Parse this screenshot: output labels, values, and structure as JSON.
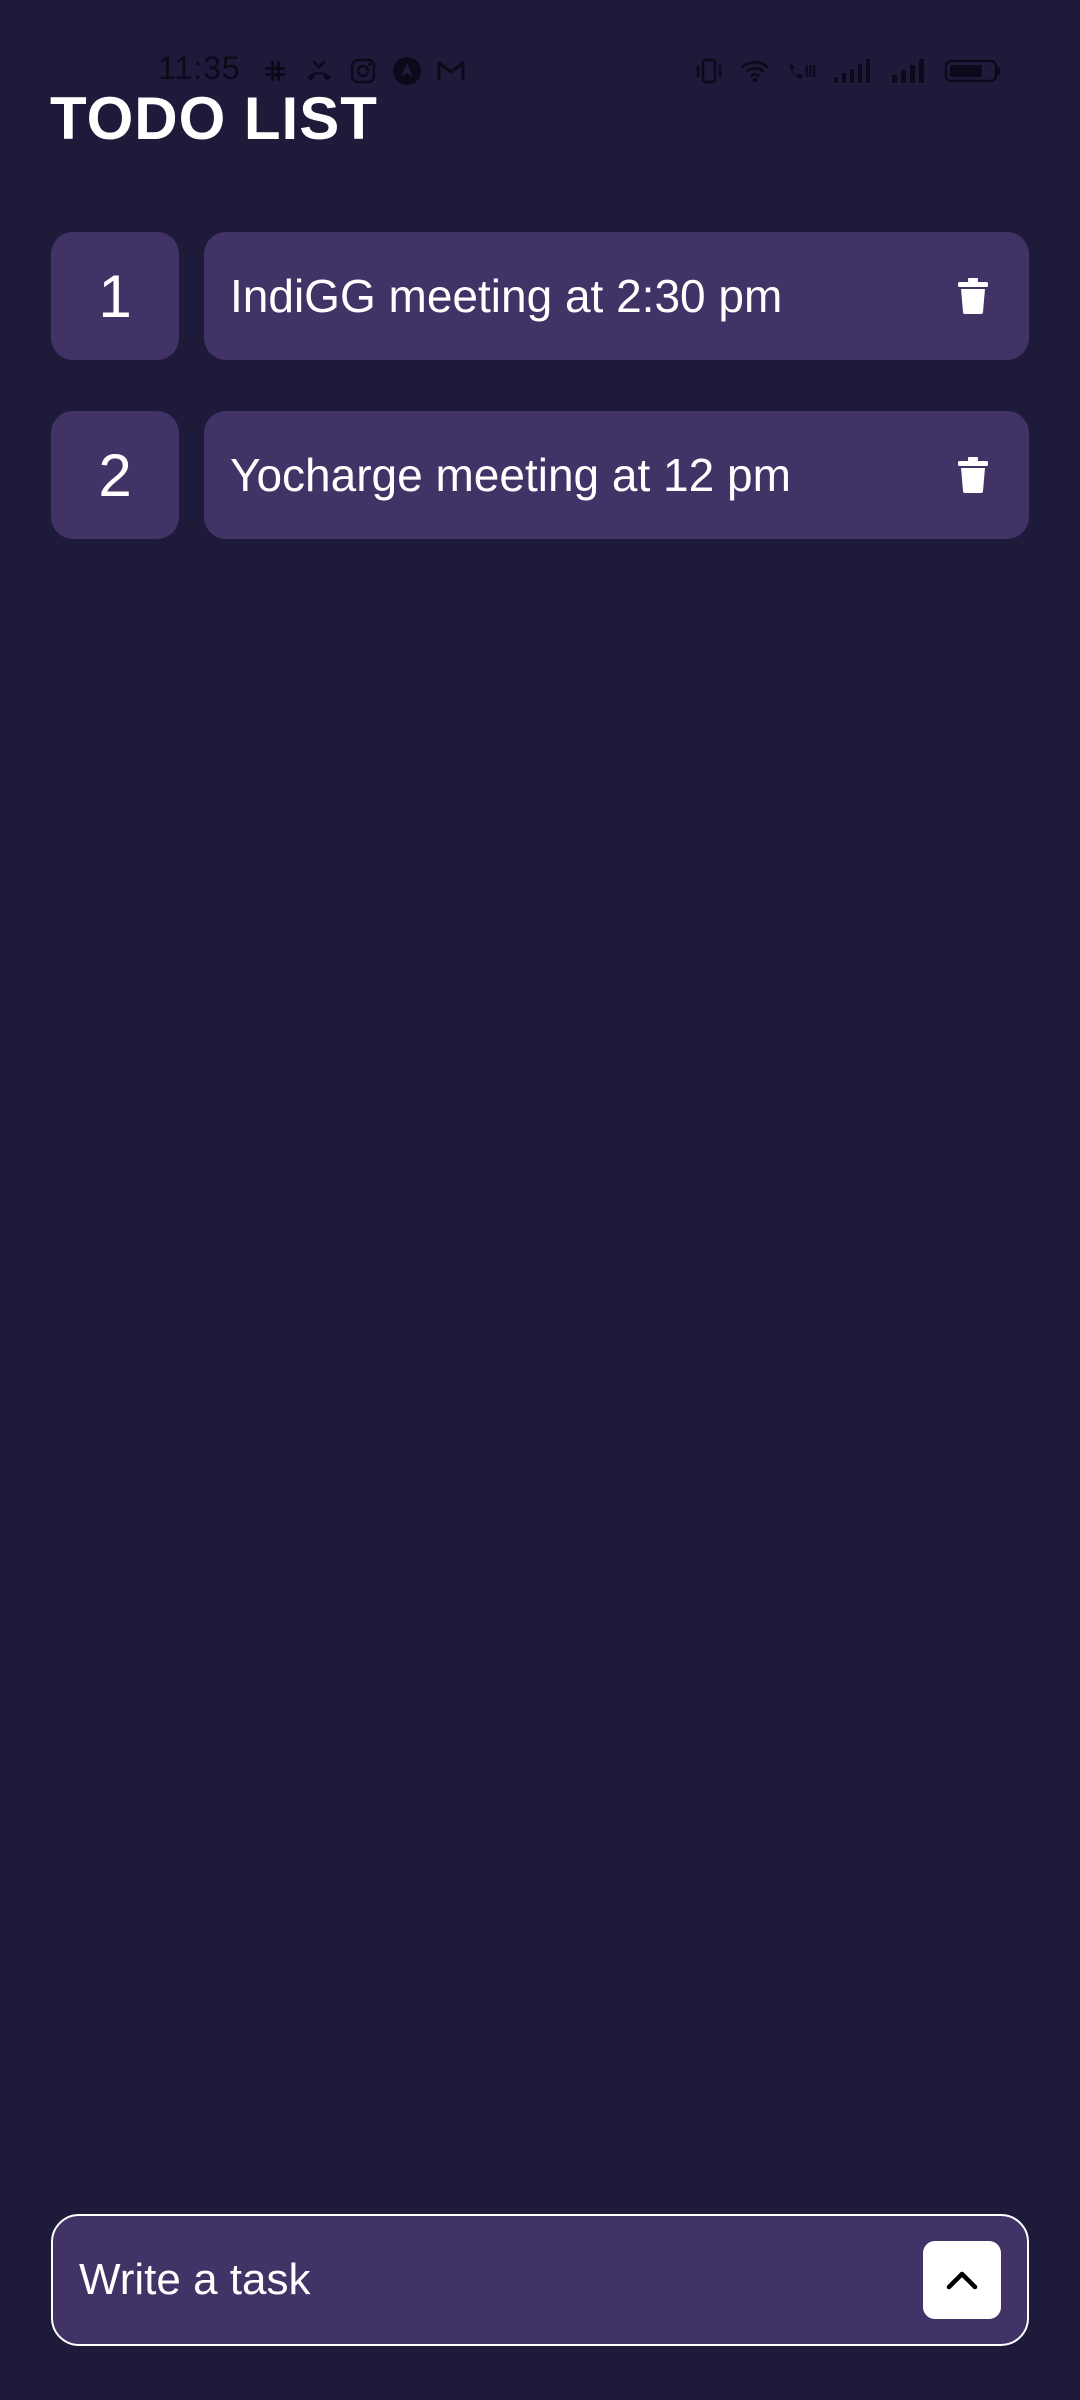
{
  "status_bar": {
    "time": "11:35",
    "left_icons": [
      "slack-icon",
      "missed-call-icon",
      "instagram-icon",
      "nav-app-icon",
      "gmail-icon"
    ],
    "right_icons": [
      "vibrate-icon",
      "wifi-icon",
      "wifi-calling-icon",
      "signal-1-icon",
      "signal-2-icon",
      "battery-icon"
    ]
  },
  "header": {
    "title": "TODO LIST"
  },
  "tasks": [
    {
      "index": "1",
      "text": "IndiGG meeting at 2:30 pm"
    },
    {
      "index": "2",
      "text": "Yocharge meeting at 12 pm"
    }
  ],
  "composer": {
    "placeholder": "Write a task",
    "value": "",
    "submit_icon": "chevron-up-icon"
  },
  "colors": {
    "background": "#1E1A3A",
    "card": "#413366",
    "text": "#FFFFFF",
    "status_icons": "#0C0A1A"
  }
}
